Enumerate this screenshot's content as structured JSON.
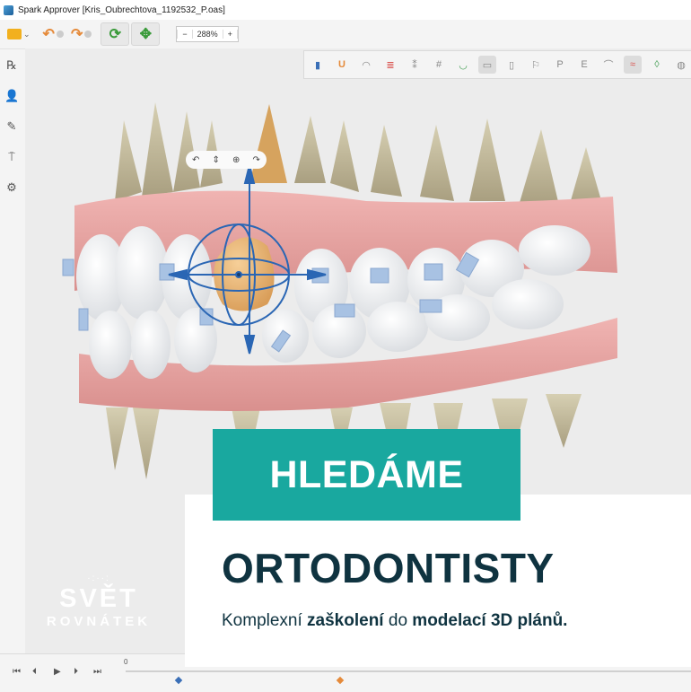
{
  "window": {
    "title": "Spark Approver [Kris_Oubrechtova_1192532_P.oas]"
  },
  "toolbar": {
    "zoom_minus": "−",
    "zoom_value": "288%",
    "zoom_plus": "+"
  },
  "left_tools": [
    {
      "name": "rx-icon",
      "glyph": "℞"
    },
    {
      "name": "patient-icon",
      "glyph": "👤"
    },
    {
      "name": "pen-icon",
      "glyph": "✎"
    },
    {
      "name": "tooth-add-icon",
      "glyph": "⍑"
    },
    {
      "name": "settings-tooth-icon",
      "glyph": "⚙"
    }
  ],
  "right_tools": [
    "▮",
    "U",
    "◠",
    "≣",
    "⁑",
    "#",
    "◡",
    "▭",
    "▯",
    "⚐",
    "P",
    "E",
    "⌒",
    "≈",
    "◊",
    "◍"
  ],
  "rotation_tool": {
    "a": "↶",
    "b": "⇕",
    "c": "⊕",
    "d": "↷"
  },
  "playback": {
    "first": "⏮",
    "prev": "⏴",
    "play": "▶",
    "next": "⏵",
    "last": "⏭",
    "timeline_start": "0"
  },
  "colors": {
    "teal": "#19a89f",
    "navy": "#0f3340",
    "gum": "#e9a7a5",
    "tooth": "#f3f3f1",
    "root": "#c9c1a3",
    "highlight": "#e8b67a",
    "gizmo": "#2a66b4",
    "bracket": "#a8c2e3"
  },
  "overlay": {
    "badge": "HLEDÁME",
    "headline": "ORTODONTISTY",
    "sub_a": "Komplexní ",
    "sub_b": "zaškolení",
    "sub_c": " do ",
    "sub_d": "modelací 3D plánů."
  },
  "logo": {
    "dots": "·:··:",
    "main": "SVĚT",
    "sub": "ROVNÁTEK"
  }
}
